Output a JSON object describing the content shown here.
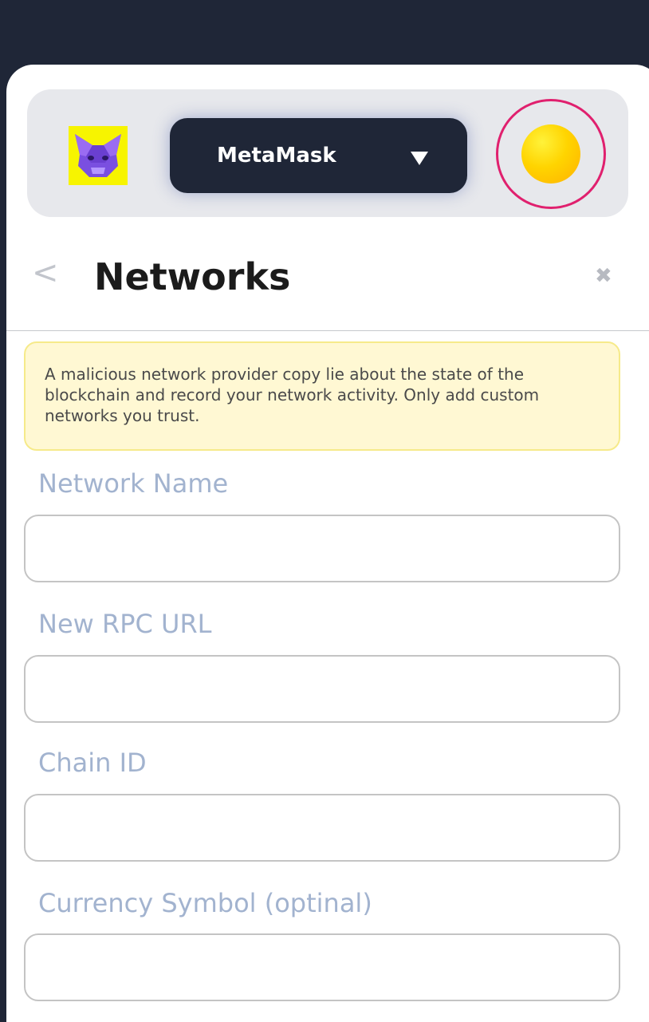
{
  "header": {
    "network_select_label": "MetaMask",
    "logo_icon": "metamask-fox-icon",
    "avatar_icon": "account-avatar"
  },
  "page": {
    "title": "Networks",
    "back_glyph": "<",
    "close_glyph": "✖"
  },
  "warning": {
    "text": "A malicious network provider copy lie about the state of the blockchain and record your network activity. Only add custom networks you trust."
  },
  "form": {
    "fields": [
      {
        "label": "Network Name",
        "value": ""
      },
      {
        "label": "New RPC URL",
        "value": ""
      },
      {
        "label": "Chain ID",
        "value": ""
      },
      {
        "label": "Currency Symbol (optinal)",
        "value": ""
      }
    ]
  },
  "colors": {
    "background": "#1f2637",
    "accent_ring": "#e0206e",
    "label": "#a2b3cf",
    "warning_bg": "#fff8d3"
  }
}
